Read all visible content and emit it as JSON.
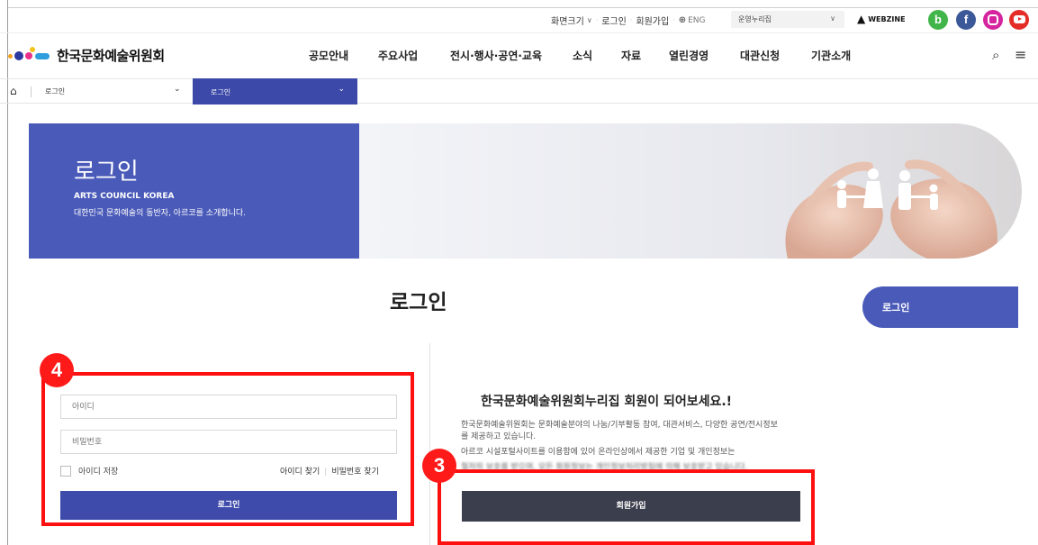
{
  "utility": {
    "font_size_label": "화면크기",
    "login_link": "로그인",
    "signup_link": "회원가입",
    "eng_link": "ENG",
    "site_select_value": "운영누리집",
    "webzine_label": "WEBZINE",
    "sns": {
      "blog": "b",
      "facebook": "f"
    }
  },
  "header": {
    "org_name": "한국문화예술위원회",
    "menu": [
      "공모안내",
      "주요사업",
      "전시·행사·공연·교육",
      "소식",
      "자료",
      "열린경영",
      "대관신청",
      "기관소개"
    ]
  },
  "breadcrumb": {
    "depth1": "로그인",
    "depth2": "로그인"
  },
  "banner": {
    "title": "로그인",
    "subtitle_en": "ARTS COUNCIL KOREA",
    "subtitle_ko": "대한민국 문화예술의 동반자, 아르코를 소개합니다."
  },
  "page": {
    "title": "로그인",
    "side_menu_active": "로그인"
  },
  "login_form": {
    "id_placeholder": "아이디",
    "pw_placeholder": "비밀번호",
    "remember_label": "아이디 저장",
    "find_id": "아이디 찾기",
    "find_pw": "비밀번호 찾기",
    "submit": "로그인"
  },
  "join": {
    "heading": "한국문화예술위원회누리집 회원이 되어보세요.!",
    "desc1": "한국문화예술위원회는 문화예술분야의 나눔/기부활동 참여, 대관서비스, 다양한 공연/전시정보를 제공하고 있습니다.",
    "desc2": "아르코 시설포털사이트를 이용함에 있어 온라인상에서 제공한 기업 및 개인정보는",
    "desc3": "철저히 보호를 받으며, 모든 회원정보는 개인정보처리방침에 의해 보호받고 있습니다.",
    "button": "회원가입"
  },
  "annotations": {
    "login_box": "4",
    "join_box": "3"
  },
  "colors": {
    "primary": "#4a5ab8",
    "button": "#3e4bab",
    "join_button": "#3b3e4d",
    "highlight": "#ff1010"
  }
}
